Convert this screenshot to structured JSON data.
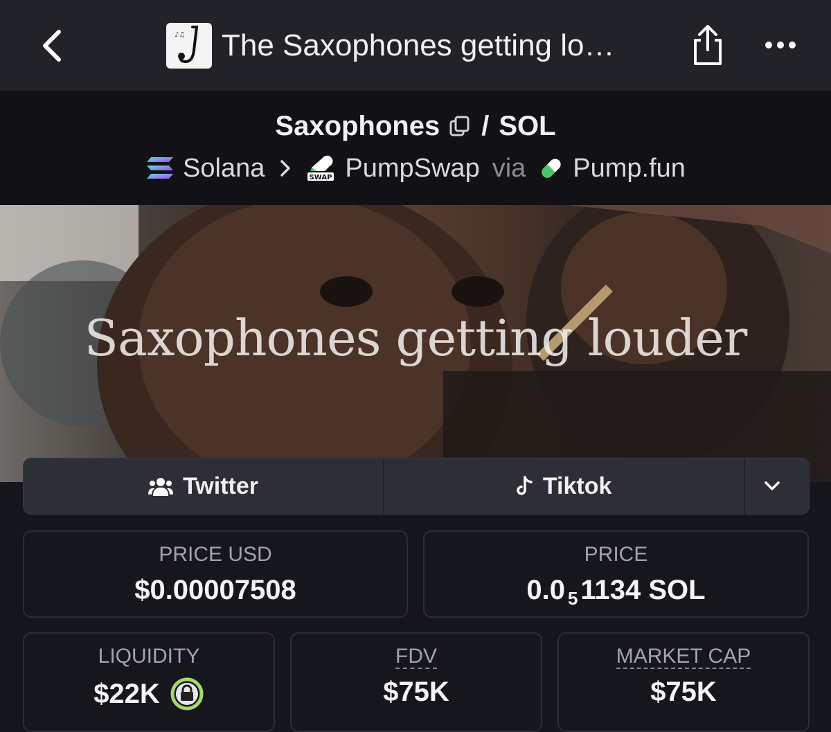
{
  "topbar": {
    "title": "The Saxophones getting lo…",
    "icons": [
      "chevron-left-icon",
      "saxophone-thumbnail",
      "share-icon",
      "more-icon"
    ]
  },
  "pair": {
    "base": "Saxophones",
    "separator": "/",
    "quote": "SOL"
  },
  "chain": {
    "network": "Solana",
    "dex": "PumpSwap",
    "via": "via",
    "launchpad": "Pump.fun",
    "dex_badge": "SWAP"
  },
  "banner": {
    "caption": "Saxophones getting louder"
  },
  "links": {
    "twitter": "Twitter",
    "tiktok": "Tiktok"
  },
  "stats": {
    "price_usd_label": "PRICE USD",
    "price_usd_value": "$0.00007508",
    "price_label": "PRICE",
    "price_prefix": "0.0",
    "price_zeros": "5",
    "price_suffix": "1134 SOL",
    "liquidity_label": "LIQUIDITY",
    "liquidity_value": "$22K",
    "fdv_label": "FDV",
    "fdv_value": "$75K",
    "mcap_label": "MARKET CAP",
    "mcap_value": "$75K"
  },
  "colors": {
    "bg": "#15151c",
    "topbar": "#222229",
    "lock_ring": "#a3d96b"
  }
}
